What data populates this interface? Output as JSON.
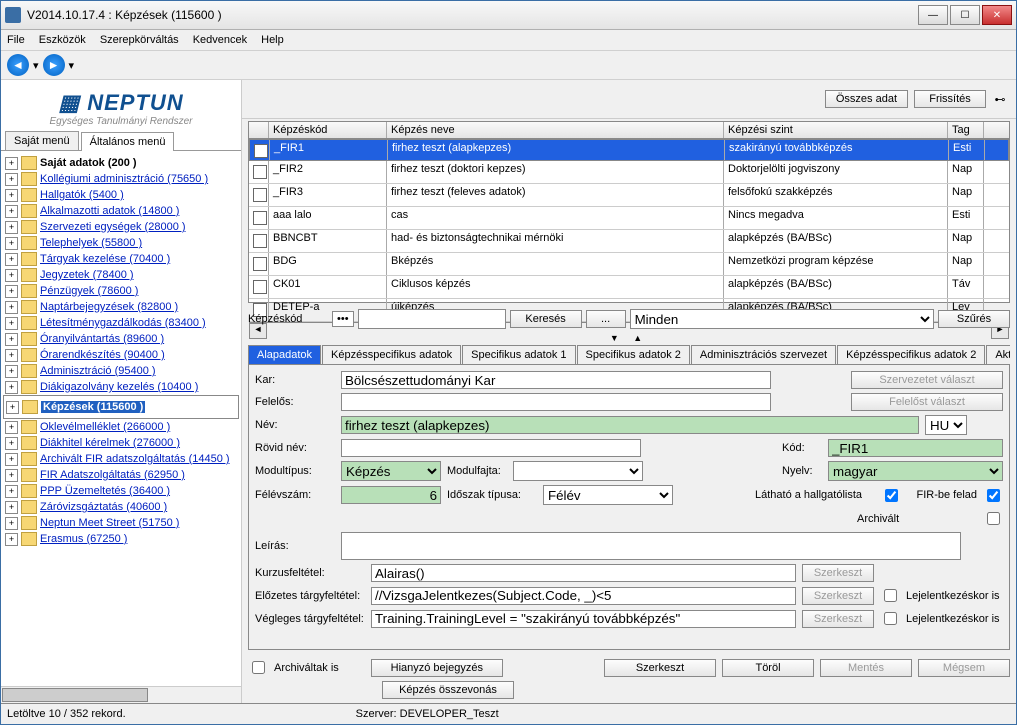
{
  "title": "V2014.10.17.4 : Képzések (115600 )",
  "menu": [
    "File",
    "Eszközök",
    "Szerepkörváltás",
    "Kedvencek",
    "Help"
  ],
  "logo": {
    "brand": "NEPTUN",
    "sub": "Egységes Tanulmányi Rendszer"
  },
  "leftTabs": [
    "Saját menü",
    "Általános menü"
  ],
  "tree": [
    {
      "label": "Saját adatok (200  )",
      "bold": true
    },
    {
      "label": "Kollégiumi adminisztráció (75650  )"
    },
    {
      "label": "Hallgatók (5400  )"
    },
    {
      "label": "Alkalmazotti adatok (14800  )"
    },
    {
      "label": "Szervezeti egységek (28000  )"
    },
    {
      "label": "Telephelyek (55800  )"
    },
    {
      "label": "Tárgyak kezelése (70400  )"
    },
    {
      "label": "Jegyzetek (78400  )"
    },
    {
      "label": "Pénzügyek (78600  )"
    },
    {
      "label": "Naptárbejegyzések (82800  )"
    },
    {
      "label": "Létesítménygazdálkodás (83400  )"
    },
    {
      "label": "Óranyilvántartás (89600  )"
    },
    {
      "label": "Órarendkészítés (90400  )"
    },
    {
      "label": "Adminisztráció (95400  )"
    },
    {
      "label": "Diákigazolvány kezelés (10400  )"
    },
    {
      "label": "Képzések (115600  )",
      "sel": true
    },
    {
      "label": "Oklevélmelléklet (266000  )"
    },
    {
      "label": "Diákhitel kérelmek (276000  )"
    },
    {
      "label": "Archivált FIR adatszolgáltatás (14450  )"
    },
    {
      "label": "FIR Adatszolgáltatás (62950  )"
    },
    {
      "label": "PPP Üzemeltetés (36400  )"
    },
    {
      "label": "Záróvizsgáztatás (40600  )"
    },
    {
      "label": "Neptun Meet Street (51750  )"
    },
    {
      "label": "Erasmus (67250  )"
    }
  ],
  "topBtns": {
    "all": "Összes adat",
    "refresh": "Frissítés"
  },
  "gridHead": [
    "",
    "Képzéskód",
    "Képzés neve",
    "Képzési szint",
    "Tag"
  ],
  "gridRows": [
    {
      "code": "_FIR1",
      "name": "firhez teszt (alapkepzes)",
      "level": "szakirányú továbbképzés",
      "tag": "Esti",
      "sel": true
    },
    {
      "code": "_FIR2",
      "name": "firhez teszt (doktori kepzes)",
      "level": "Doktorjelölti jogviszony",
      "tag": "Nap"
    },
    {
      "code": "_FIR3",
      "name": "firhez teszt (feleves adatok)",
      "level": "felsőfokú szakképzés",
      "tag": "Nap"
    },
    {
      "code": "aaa lalo",
      "name": "cas",
      "level": "Nincs megadva",
      "tag": "Esti"
    },
    {
      "code": "BBNCBT",
      "name": "had- és biztonságtechnikai mérnöki",
      "level": "alapképzés (BA/BSc)",
      "tag": "Nap"
    },
    {
      "code": "BDG",
      "name": "Bképzés",
      "level": "Nemzetközi program képzése",
      "tag": "Nap"
    },
    {
      "code": "CK01",
      "name": "Ciklusos képzés",
      "level": "alapképzés (BA/BSc)",
      "tag": "Táv"
    },
    {
      "code": "DETEP-a",
      "name": "újképzés",
      "level": "alapképzés (BA/BSc)",
      "tag": "Lev"
    }
  ],
  "search": {
    "label": "Képzéskód",
    "btn": "Keresés",
    "dots": "...",
    "combo": "Minden",
    "filter": "Szűrés"
  },
  "detailTabs": [
    "Alapadatok",
    "Képzésspecifikus adatok",
    "Specifikus adatok 1",
    "Specifikus adatok 2",
    "Adminisztrációs szervezet",
    "Képzésspecifikus adatok 2",
    "Aktu"
  ],
  "form": {
    "karL": "Kar:",
    "kar": "Bölcsészettudományi Kar",
    "szervBtn": "Szervezetet választ",
    "felL": "Felelős:",
    "fel": "",
    "felBtn": "Felelőst választ",
    "nevL": "Név:",
    "nev": "firhez teszt (alapkepzes)",
    "lang": "HU",
    "rovidL": "Rövid név:",
    "rovid": "",
    "kodL": "Kód:",
    "kod": "_FIR1",
    "modTL": "Modultípus:",
    "modT": "Képzés",
    "modFL": "Modulfajta:",
    "modF": "",
    "nyelvL": "Nyelv:",
    "nyelv": "magyar",
    "felevL": "Félévszám:",
    "felev": "6",
    "idoTL": "Időszak típusa:",
    "idoT": "Félév",
    "lathL": "Látható a hallgatólista",
    "firL": "FIR-be felad",
    "archL": "Archivált",
    "leirasL": "Leírás:",
    "leiras": "",
    "kurzL": "Kurzusfeltétel:",
    "kurz": "Alairas()",
    "eloL": "Előzetes tárgyfeltétel:",
    "elo": "//VizsgaJelentkezes(Subject.Code, _)<5",
    "vegL": "Végleges tárgyfeltétel:",
    "veg": "Training.TrainingLevel = \"szakirányú továbbképzés\"",
    "szerk": "Szerkeszt",
    "lejL": "Lejelentkezéskor is"
  },
  "bottomBtns": {
    "hianyzo": "Hianyzó bejegyzés",
    "osszevon": "Képzés összevonás",
    "archChk": "Archiváltak is",
    "szerk": "Szerkeszt",
    "torol": "Töröl",
    "mentes": "Mentés",
    "megsem": "Mégsem"
  },
  "status": {
    "left": "Letöltve 10 / 352 rekord.",
    "server": "Szerver: DEVELOPER_Teszt"
  }
}
